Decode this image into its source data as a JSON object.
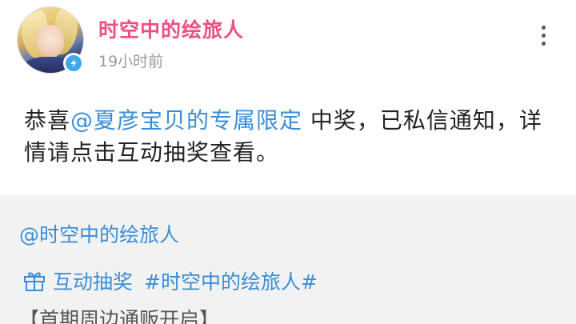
{
  "post": {
    "author_name": "时空中的绘旅人",
    "time": "19小时前",
    "text_prefix": "恭喜",
    "mention": "@夏彦宝贝的专属限定",
    "text_suffix": " 中奖，已私信通知，详情请点击互动抽奖查看。"
  },
  "repost": {
    "author_mention": "@时空中的绘旅人",
    "lottery_label": "互动抽奖",
    "topic_tag": "#时空中的绘旅人#",
    "text": "【首期周边通贩开启】"
  },
  "icons": {
    "verified": "verified-check-icon",
    "more": "more-vertical-icon",
    "gift": "gift-icon"
  },
  "colors": {
    "author": "#ec4f84",
    "link": "#3a8ed8",
    "badge": "#3da9ef",
    "repost_bg": "#f2f2f2"
  }
}
